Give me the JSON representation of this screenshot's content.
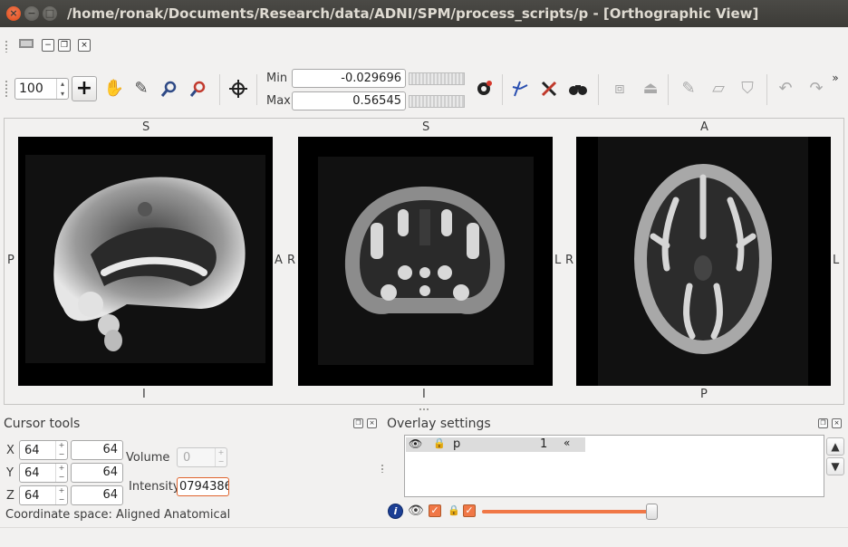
{
  "window": {
    "title": "/home/ronak/Documents/Research/data/ADNI/SPM/process_scripts/p - [Orthographic View]"
  },
  "toolbar": {
    "zoom_value": "100",
    "min_label": "Min",
    "max_label": "Max",
    "min_value": "-0.029696",
    "max_value": "0.56545"
  },
  "views": {
    "sagittal": {
      "top": "S",
      "bottom": "I",
      "left": "P",
      "right": "A"
    },
    "coronal": {
      "top": "S",
      "bottom": "I",
      "left": "R",
      "right": "L"
    },
    "axial": {
      "top": "A",
      "bottom": "P",
      "left": "R",
      "right": "L"
    }
  },
  "cursor_tools": {
    "title": "Cursor tools",
    "x_label": "X",
    "y_label": "Y",
    "z_label": "Z",
    "x_voxel": "64",
    "y_voxel": "64",
    "z_voxel": "64",
    "x_world": "64",
    "y_world": "64",
    "z_world": "64",
    "volume_label": "Volume",
    "volume_value": "0",
    "intensity_label": "Intensity",
    "intensity_value": "0794386",
    "coordinate_space": "Coordinate space: Aligned Anatomical"
  },
  "overlay_settings": {
    "title": "Overlay settings",
    "layers": [
      {
        "name": "p",
        "volume": "1"
      }
    ],
    "opacity": 1.0
  }
}
